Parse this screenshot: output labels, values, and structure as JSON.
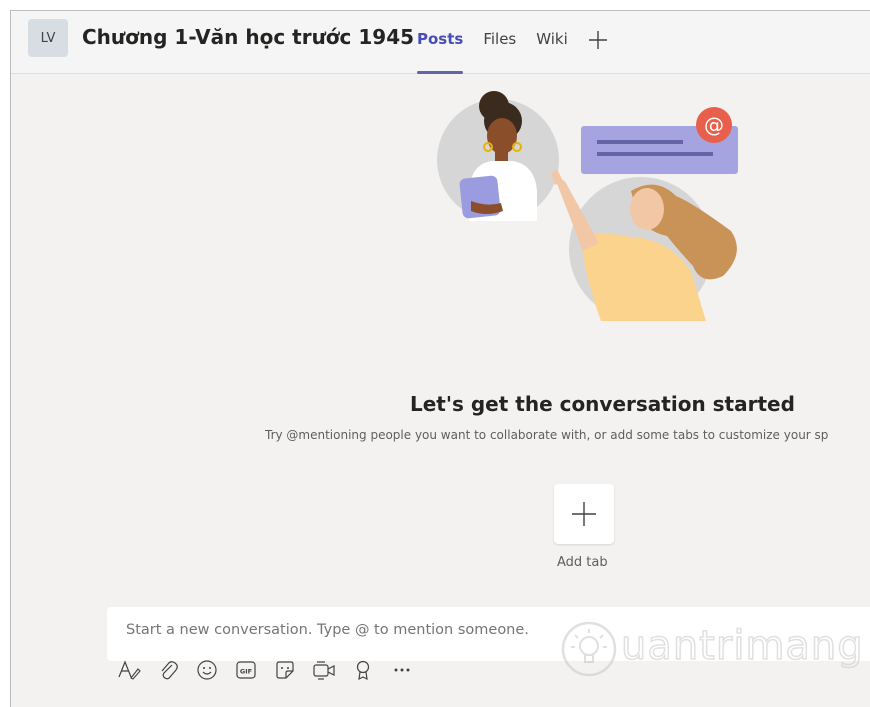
{
  "header": {
    "avatar_initials": "LV",
    "team_title": "Chương 1-Văn học trước 1945",
    "tabs": [
      {
        "label": "Posts",
        "active": true
      },
      {
        "label": "Files",
        "active": false
      },
      {
        "label": "Wiki",
        "active": false
      }
    ],
    "add_tab_icon": "plus-icon"
  },
  "empty_state": {
    "title": "Let's get the conversation started",
    "subtitle": "Try @mentioning people you want to collaborate with, or add some tabs to customize your sp",
    "add_tab_label": "Add tab"
  },
  "compose": {
    "placeholder": "Start a new conversation. Type @ to mention someone."
  },
  "toolbar": {
    "icons": [
      "format-icon",
      "attach-icon",
      "emoji-icon",
      "gif-icon",
      "sticker-icon",
      "meet-now-icon",
      "praise-icon",
      "more-options-icon"
    ]
  },
  "watermark": {
    "text": "uantrimang"
  },
  "colors": {
    "accent": "#6264a7",
    "background": "#f3f2f1",
    "mention_badge": "#e8604c"
  }
}
